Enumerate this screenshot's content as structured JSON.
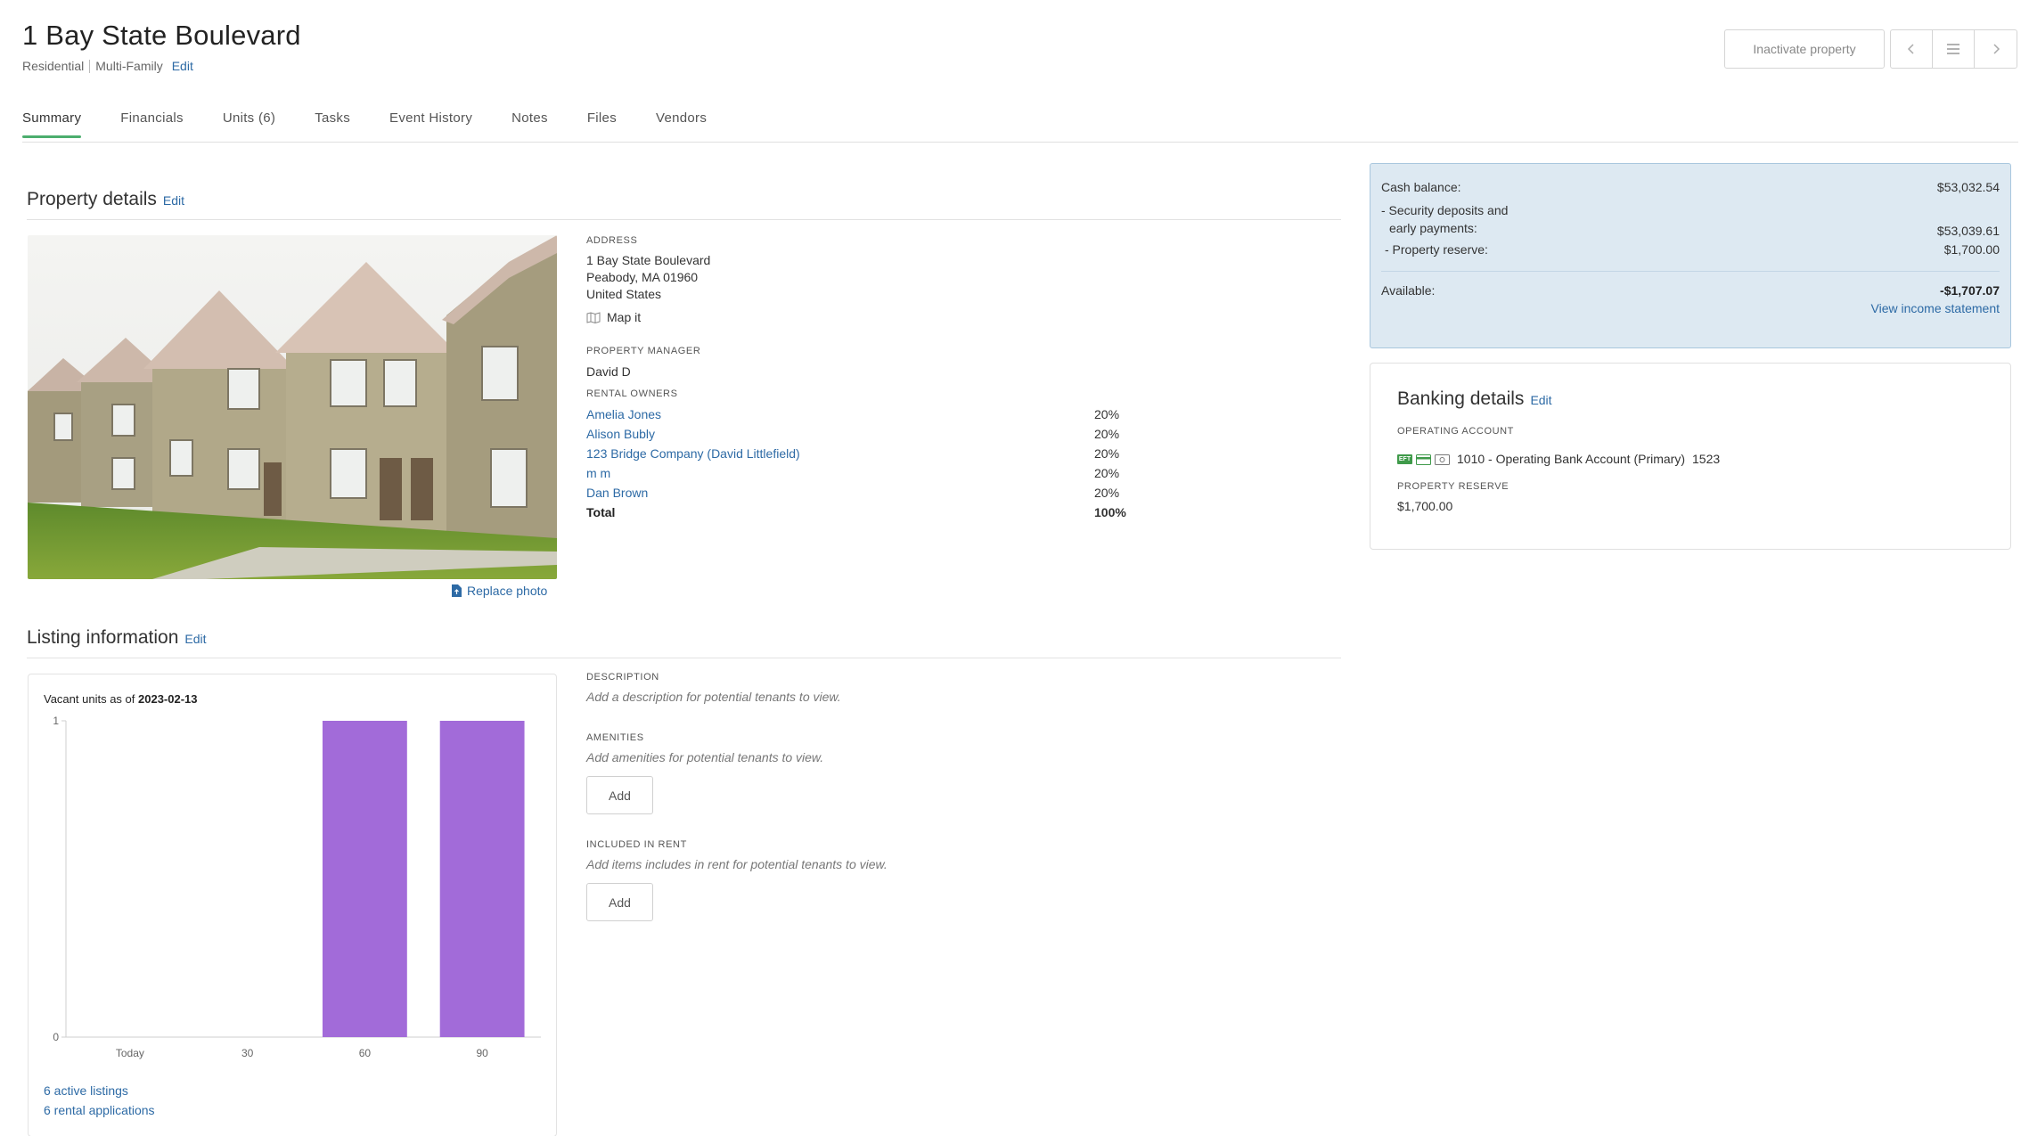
{
  "header": {
    "title": "1 Bay State Boulevard",
    "type": "Residential",
    "subtype": "Multi-Family",
    "edit_label": "Edit",
    "inactivate_label": "Inactivate property"
  },
  "tabs": [
    {
      "label": "Summary"
    },
    {
      "label": "Financials"
    },
    {
      "label": "Units (6)"
    },
    {
      "label": "Tasks"
    },
    {
      "label": "Event History"
    },
    {
      "label": "Notes"
    },
    {
      "label": "Files"
    },
    {
      "label": "Vendors"
    }
  ],
  "property_details": {
    "heading": "Property details",
    "edit_label": "Edit",
    "replace_photo_label": "Replace photo",
    "address_label": "ADDRESS",
    "address_line1": "1 Bay State Boulevard",
    "address_line2": "Peabody, MA 01960",
    "address_line3": "United States",
    "map_label": "Map it",
    "manager_label": "PROPERTY MANAGER",
    "manager": "David D",
    "owners_label": "RENTAL OWNERS",
    "owners": [
      {
        "name": "Amelia Jones",
        "pct": "20%"
      },
      {
        "name": "Alison Bubly",
        "pct": "20%"
      },
      {
        "name": "123 Bridge Company (David Littlefield)",
        "pct": "20%"
      },
      {
        "name": "m m",
        "pct": "20%"
      },
      {
        "name": "Dan Brown",
        "pct": "20%"
      }
    ],
    "total_label": "Total",
    "total_pct": "100%"
  },
  "cash": {
    "cash_balance_label": "Cash balance:",
    "cash_balance": "$53,032.54",
    "deposits_label_1": "- Security deposits and",
    "deposits_label_2": "early payments:",
    "deposits": "$53,039.61",
    "reserve_label": "- Property reserve:",
    "reserve": "$1,700.00",
    "available_label": "Available:",
    "available": "-$1,707.07",
    "income_link": "View income statement"
  },
  "banking": {
    "heading": "Banking details",
    "edit_label": "Edit",
    "operating_label": "OPERATING ACCOUNT",
    "operating_account": "1010 - Operating Bank Account (Primary)",
    "operating_number": "1523",
    "eft_label": "EFT",
    "reserve_label": "PROPERTY RESERVE",
    "reserve": "$1,700.00"
  },
  "listing": {
    "heading": "Listing information",
    "edit_label": "Edit",
    "chart_title_prefix": "Vacant units as of ",
    "chart_title_date": "2023-02-13",
    "active_listings": "6 active listings",
    "rental_applications": "6 rental applications",
    "description_label": "DESCRIPTION",
    "description_placeholder": "Add a description for potential tenants to view.",
    "amenities_label": "AMENITIES",
    "amenities_placeholder": "Add amenities for potential tenants to view.",
    "included_label": "INCLUDED IN RENT",
    "included_placeholder": "Add items includes in rent for potential tenants to view.",
    "add_label": "Add"
  },
  "colors": {
    "accent": "#2d6aa5",
    "tab_active": "#4cae6e",
    "bar": "#a26bd9",
    "panel_bg": "#dde9f2"
  },
  "chart_data": {
    "type": "bar",
    "title": "Vacant units as of 2023-02-13",
    "categories": [
      "Today",
      "30",
      "60",
      "90"
    ],
    "values": [
      0,
      0,
      1,
      1
    ],
    "ylim": [
      0,
      1
    ],
    "yticks": [
      "0",
      "1"
    ],
    "xlabel": "",
    "ylabel": "",
    "grid": false,
    "legend": "none"
  }
}
